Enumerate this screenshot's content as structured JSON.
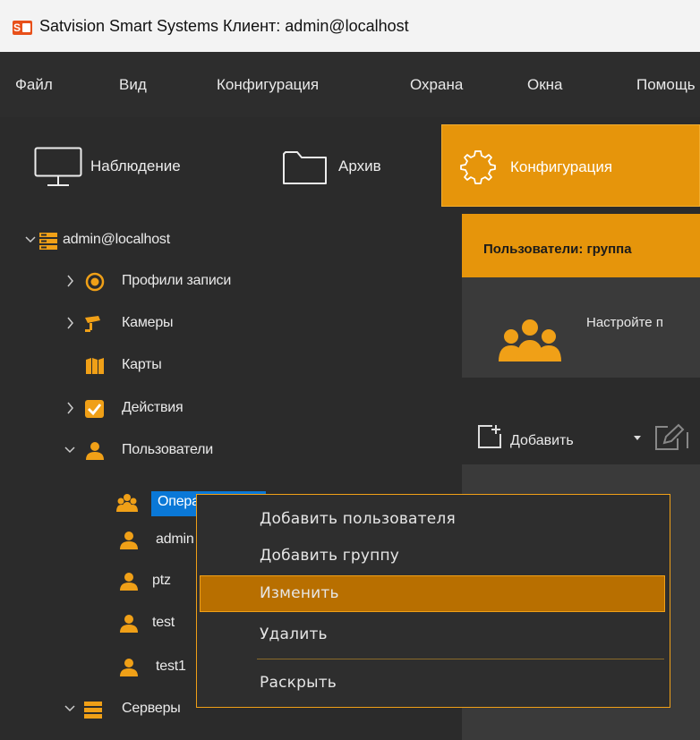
{
  "window": {
    "title": "Satvision Smart Systems Клиент: admin@localhost",
    "logo_letter": "S"
  },
  "menubar": {
    "items": [
      "Файл",
      "Вид",
      "Конфигурация",
      "Охрана",
      "Окна",
      "Помощь"
    ]
  },
  "mode_tabs": [
    {
      "label": "Наблюдение",
      "icon": "monitor-icon"
    },
    {
      "label": "Архив",
      "icon": "folder-icon"
    },
    {
      "label": "Конфигурация",
      "icon": "gear-icon",
      "active": true
    }
  ],
  "tree": {
    "root": "admin@localhost",
    "items": [
      {
        "label": "Профили записи",
        "icon": "record-profile-icon"
      },
      {
        "label": "Камеры",
        "icon": "camera-icon"
      },
      {
        "label": "Карты",
        "icon": "map-icon"
      },
      {
        "label": "Действия",
        "icon": "checkbox-icon"
      },
      {
        "label": "Пользователи",
        "icon": "user-icon"
      },
      {
        "label": "Операторы",
        "icon": "users-group-icon",
        "selected": true
      },
      {
        "label": "admin",
        "icon": "user-icon"
      },
      {
        "label": "ptz",
        "icon": "user-icon"
      },
      {
        "label": "test",
        "icon": "user-icon"
      },
      {
        "label": "test1",
        "icon": "user-icon"
      },
      {
        "label": "Серверы",
        "icon": "server-icon"
      }
    ]
  },
  "panel": {
    "header": "Пользователи: группа",
    "info": "Настройте п",
    "toolbar": {
      "add_label": "Добавить"
    }
  },
  "context_menu": {
    "items": [
      "Добавить пользователя",
      "Добавить группу",
      "Изменить",
      "Удалить",
      "Раскрыть"
    ],
    "highlighted": "Изменить"
  },
  "colors": {
    "accent": "#e6950b",
    "selection": "#0a78d7",
    "background": "#2b2b2b"
  }
}
